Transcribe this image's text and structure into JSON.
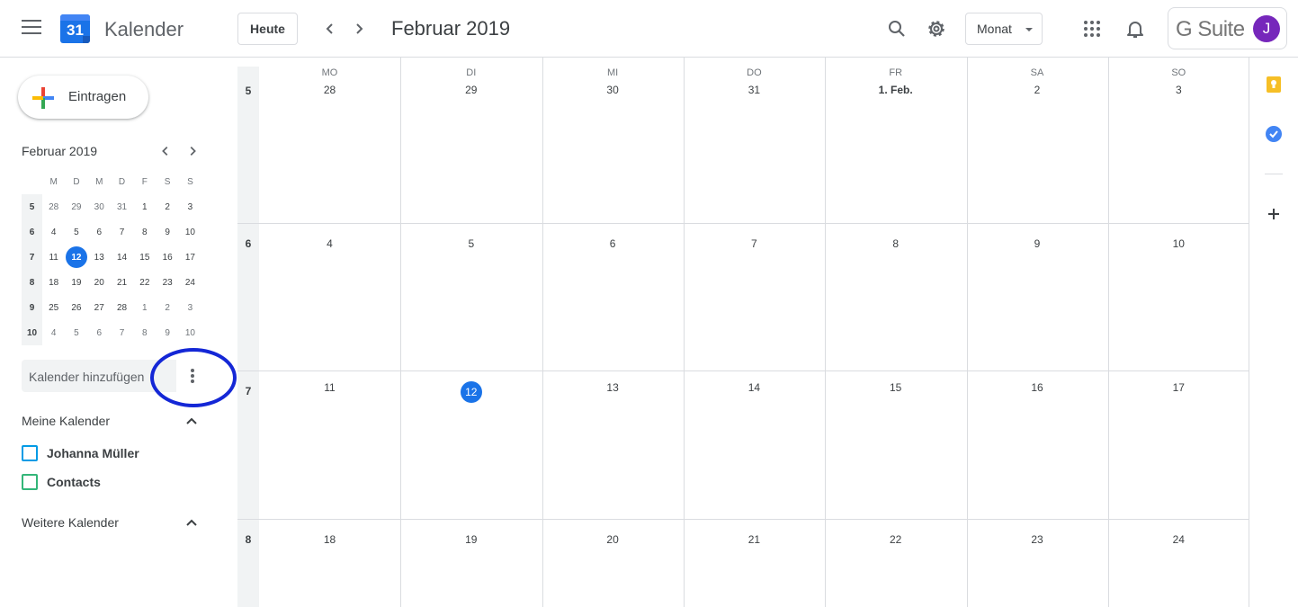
{
  "header": {
    "app_name": "Kalender",
    "logo_day": "31",
    "today_label": "Heute",
    "month_title": "Februar 2019",
    "view_label": "Monat",
    "brand": "G Suite",
    "avatar_initial": "J"
  },
  "sidebar": {
    "create_label": "Eintragen",
    "mini_month_title": "Februar 2019",
    "weekday_heads": [
      "M",
      "D",
      "M",
      "D",
      "F",
      "S",
      "S"
    ],
    "mini_weeks": [
      {
        "wk": "5",
        "days": [
          "28",
          "29",
          "30",
          "31",
          "1",
          "2",
          "3"
        ]
      },
      {
        "wk": "6",
        "days": [
          "4",
          "5",
          "6",
          "7",
          "8",
          "9",
          "10"
        ]
      },
      {
        "wk": "7",
        "days": [
          "11",
          "12",
          "13",
          "14",
          "15",
          "16",
          "17"
        ]
      },
      {
        "wk": "8",
        "days": [
          "18",
          "19",
          "20",
          "21",
          "22",
          "23",
          "24"
        ]
      },
      {
        "wk": "9",
        "days": [
          "25",
          "26",
          "27",
          "28",
          "1",
          "2",
          "3"
        ]
      },
      {
        "wk": "10",
        "days": [
          "4",
          "5",
          "6",
          "7",
          "8",
          "9",
          "10"
        ]
      }
    ],
    "add_calendar_label": "Kalender hinzufügen",
    "my_calendars_title": "Meine Kalender",
    "my_calendars": [
      {
        "name": "Johanna Müller",
        "color": "#039be5"
      },
      {
        "name": "Contacts",
        "color": "#33b679"
      }
    ],
    "other_calendars_title": "Weitere Kalender"
  },
  "month_grid": {
    "day_heads": [
      "MO",
      "DI",
      "MI",
      "DO",
      "FR",
      "SA",
      "SO"
    ],
    "weeks": [
      {
        "wk": "5",
        "days": [
          "28",
          "29",
          "30",
          "31",
          "1. Feb.",
          "2",
          "3"
        ]
      },
      {
        "wk": "6",
        "days": [
          "4",
          "5",
          "6",
          "7",
          "8",
          "9",
          "10"
        ]
      },
      {
        "wk": "7",
        "days": [
          "11",
          "12",
          "13",
          "14",
          "15",
          "16",
          "17"
        ]
      },
      {
        "wk": "8",
        "days": [
          "18",
          "19",
          "20",
          "21",
          "22",
          "23",
          "24"
        ]
      }
    ]
  },
  "colors": {
    "accent": "#1a73e8",
    "avatar": "#7627bb",
    "highlight_ring": "#1427d6",
    "keep": "#f6bf26"
  }
}
